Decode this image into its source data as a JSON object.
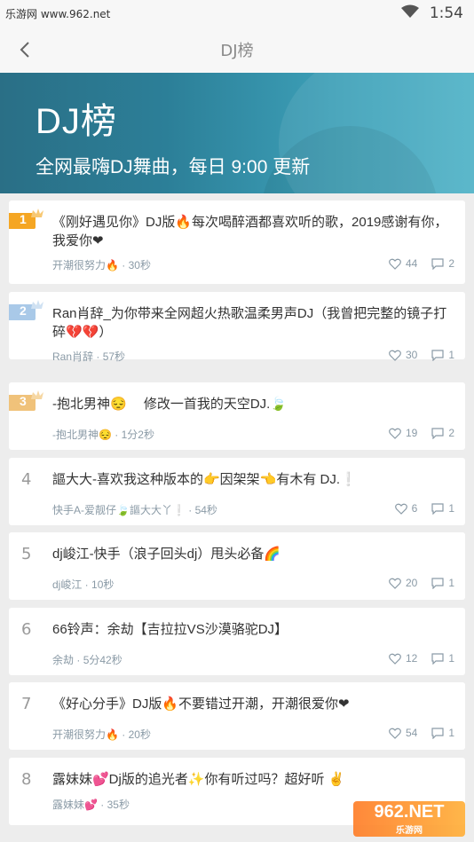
{
  "status_bar": {
    "site": "乐游网 www.962.net",
    "time": "1:54"
  },
  "nav": {
    "title": "DJ榜"
  },
  "banner": {
    "title": "DJ榜",
    "subtitle": "全网最嗨DJ舞曲，每日 9:00 更新"
  },
  "colors": {
    "gold": "#f5a623",
    "silver": "#a9c9e8",
    "bronze": "#f0c27a",
    "banner": "#2c7f98"
  },
  "items": [
    {
      "rank": "1",
      "title": "《刚好遇见你》DJ版🔥每次喝醉酒都喜欢听的歌，2019感谢有你，我爱你❤",
      "author": "开潮很努力🔥",
      "time": "30秒",
      "likes": "44",
      "comments": "2"
    },
    {
      "rank": "2",
      "title": "Ran肖辞_为你带来全网超火热歌温柔男声DJ（我曾把完整的镜子打碎💔💔）",
      "author": "Ran肖辞",
      "time": "57秒",
      "likes": "30",
      "comments": "1"
    },
    {
      "rank": "3",
      "title": "-抱北男神😔　 修改一首我的天空DJ.🍃",
      "author": "-抱北男神😔",
      "time": "1分2秒",
      "likes": "19",
      "comments": "2"
    },
    {
      "rank": "4",
      "title": "謳大大-喜欢我这种版本的👉因架架👈有木有 DJ.❕",
      "author": "快手A-爱靓仔🍃謳大大丫❕",
      "time": "54秒",
      "likes": "6",
      "comments": "1"
    },
    {
      "rank": "5",
      "title": "dj峻江-快手（浪子回头dj）甩头必备🌈",
      "author": "dj峻江",
      "time": "10秒",
      "likes": "20",
      "comments": "1"
    },
    {
      "rank": "6",
      "title": "66铃声：余劫【吉拉拉VS沙漠骆驼DJ】",
      "author": "余劫",
      "time": "5分42秒",
      "likes": "12",
      "comments": "1"
    },
    {
      "rank": "7",
      "title": "《好心分手》DJ版🔥不要错过开潮，开潮很爱你❤",
      "author": "开潮很努力🔥",
      "time": "20秒",
      "likes": "54",
      "comments": "1"
    },
    {
      "rank": "8",
      "title": "露妹妹💕Dj版的追光者✨你有听过吗？超好听 ✌",
      "author": "露妹妹💕",
      "time": "35秒",
      "likes": "",
      "comments": ""
    }
  ],
  "watermark": {
    "main": "962.NET",
    "sub": "乐游网"
  }
}
